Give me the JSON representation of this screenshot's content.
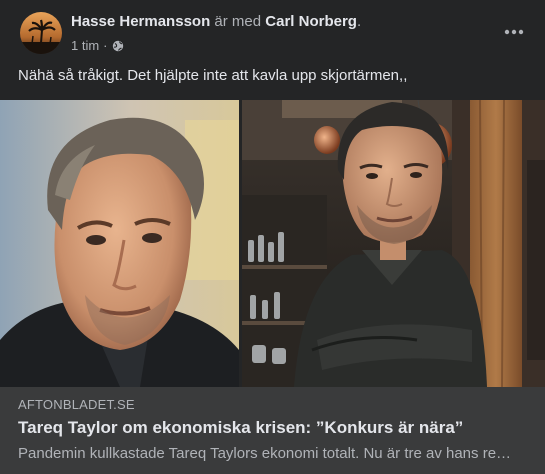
{
  "post": {
    "author": "Hasse Hermansson",
    "with_text": "är med",
    "tagged": "Carl Norberg",
    "period": ".",
    "time": "1 tim",
    "separator": "·",
    "privacy_icon": "globe-icon",
    "more_icon": "ellipsis-icon",
    "text": "Nähä så tråkigt. Det hjälpte inte att kavla upp skjortärmen,,"
  },
  "link": {
    "domain": "AFTONBLADET.SE",
    "title": "Tareq Taylor om ekonomiska krisen: ”Konkurs är nära”",
    "description": "Pandemin kullkastade Tareq Taylors ekonomi totalt. Nu är tre av hans restauranger"
  },
  "colors": {
    "background": "#242526",
    "card": "#3a3b3c",
    "primary_text": "#e4e6eb",
    "secondary_text": "#b0b3b8"
  }
}
